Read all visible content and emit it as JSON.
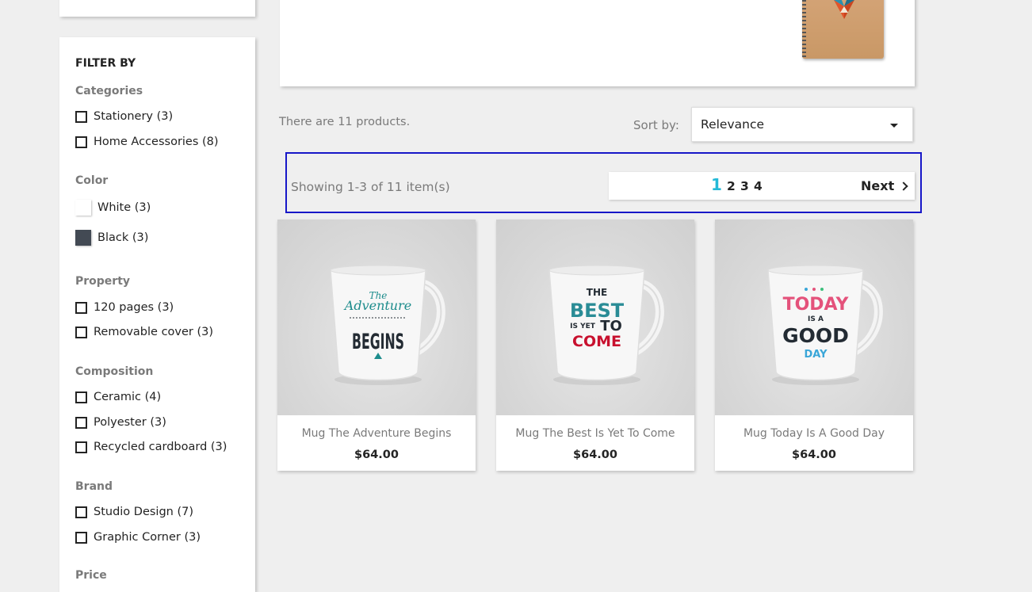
{
  "filters": {
    "title": "FILTER BY",
    "categories": {
      "title": "Categories",
      "items": [
        "Stationery (3)",
        "Home Accessories (8)"
      ]
    },
    "color": {
      "title": "Color",
      "items": [
        {
          "label": "White (3)",
          "swatch": "#ffffff"
        },
        {
          "label": "Black (3)",
          "swatch": "#434a54"
        }
      ]
    },
    "property": {
      "title": "Property",
      "items": [
        "120 pages (3)",
        "Removable cover (3)"
      ]
    },
    "composition": {
      "title": "Composition",
      "items": [
        "Ceramic (4)",
        "Polyester (3)",
        "Recycled cardboard (3)"
      ]
    },
    "brand": {
      "title": "Brand",
      "items": [
        "Studio Design (7)",
        "Graphic Corner (3)"
      ]
    },
    "price": {
      "title": "Price"
    }
  },
  "listing": {
    "count_text": "There are 11 products.",
    "sort_label": "Sort by:",
    "sort_value": "Relevance",
    "showing_text": "Showing 1-3 of 11 item(s)",
    "pages": [
      "1",
      "2",
      "3",
      "4"
    ],
    "current_page": "1",
    "next_label": "Next"
  },
  "products": [
    {
      "name": "Mug The Adventure Begins",
      "price": "$64.00",
      "mug_text": [
        "The",
        "Adventure",
        "BEGINS"
      ]
    },
    {
      "name": "Mug The Best Is Yet To Come",
      "price": "$64.00",
      "mug_text": [
        "THE",
        "BEST",
        "IS YET",
        "TO",
        "COME"
      ]
    },
    {
      "name": "Mug Today Is A Good Day",
      "price": "$64.00",
      "mug_text": [
        "TODAY",
        "IS A",
        "GOOD",
        "DAY"
      ]
    }
  ],
  "colors": {
    "accent": "#24b9d7",
    "focus_outline": "#1717c8",
    "muted_text": "#7a7a7a"
  }
}
